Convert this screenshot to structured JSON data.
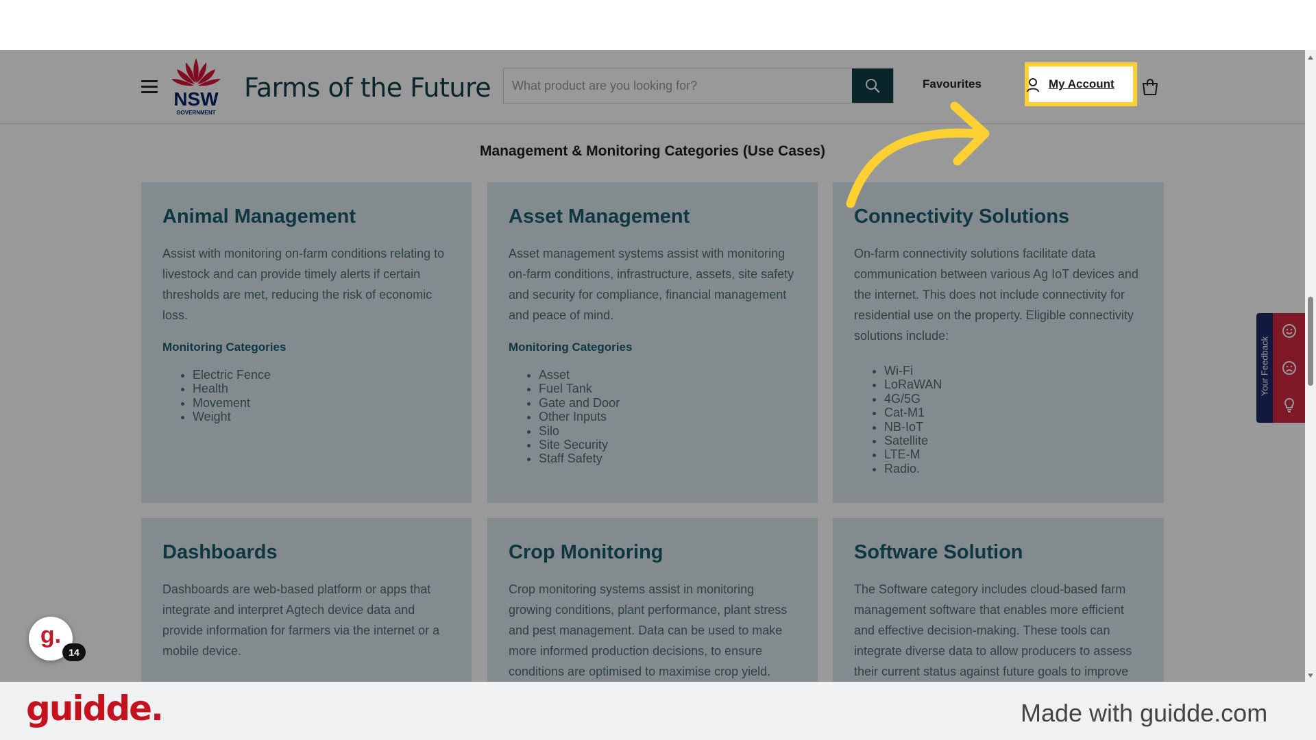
{
  "header": {
    "site_title": "Farms of the Future",
    "logo_text": "NSW",
    "logo_subtext": "GOVERNMENT",
    "search_placeholder": "What product are you looking for?",
    "favourites_label": "Favourites",
    "account_label": "My Account"
  },
  "main": {
    "heading": "Management & Monitoring Categories (Use Cases)",
    "cards": [
      {
        "title": "Animal Management",
        "description": "Assist with monitoring on-farm conditions relating to livestock and can provide timely alerts if certain thresholds are met, reducing the risk of economic loss.",
        "subheading": "Monitoring Categories",
        "items": [
          "Electric Fence",
          "Health",
          "Movement",
          "Weight"
        ]
      },
      {
        "title": "Asset Management",
        "description": "Asset management systems assist with monitoring on-farm conditions, infrastructure, assets, site safety and security for compliance, financial management and peace of mind.",
        "subheading": "Monitoring Categories",
        "items": [
          "Asset",
          "Fuel Tank",
          "Gate and Door",
          "Other Inputs",
          "Silo",
          "Site Security",
          "Staff Safety"
        ]
      },
      {
        "title": "Connectivity Solutions",
        "description": "On-farm connectivity solutions facilitate data communication between various Ag IoT devices and the internet. This does not include connectivity for residential use on the property. Eligible connectivity solutions include:",
        "items": [
          "Wi-Fi",
          "LoRaWAN",
          "4G/5G",
          "Cat-M1",
          "NB-IoT",
          "Satellite",
          "LTE-M",
          "Radio."
        ]
      },
      {
        "title": "Dashboards",
        "description": "Dashboards are web-based platform or apps that integrate and interpret Agtech device data and provide information for farmers via the internet or a mobile device."
      },
      {
        "title": "Crop Monitoring",
        "description": "Crop monitoring systems assist in monitoring growing conditions, plant performance, plant stress and pest management. Data can be used to make more informed production decisions, to ensure conditions are optimised to maximise crop yield."
      },
      {
        "title": "Software Solution",
        "description": "The Software category includes cloud-based farm management software that enables more efficient and effective decision-making. These tools can integrate diverse data to allow producers to assess their current status against future goals to improve"
      }
    ]
  },
  "feedback": {
    "label": "Your Feedback",
    "icons": [
      "smile-icon",
      "frown-icon",
      "lightbulb-icon"
    ]
  },
  "guidde_widget": {
    "letter": "g.",
    "badge_count": "14"
  },
  "footer": {
    "brand": "guidde.",
    "made_with": "Made with guidde.com"
  },
  "colors": {
    "highlight": "#fdd132",
    "brand_dark": "#123f47",
    "card_title": "#1a5d6e",
    "guidde_red": "#c5121f"
  }
}
